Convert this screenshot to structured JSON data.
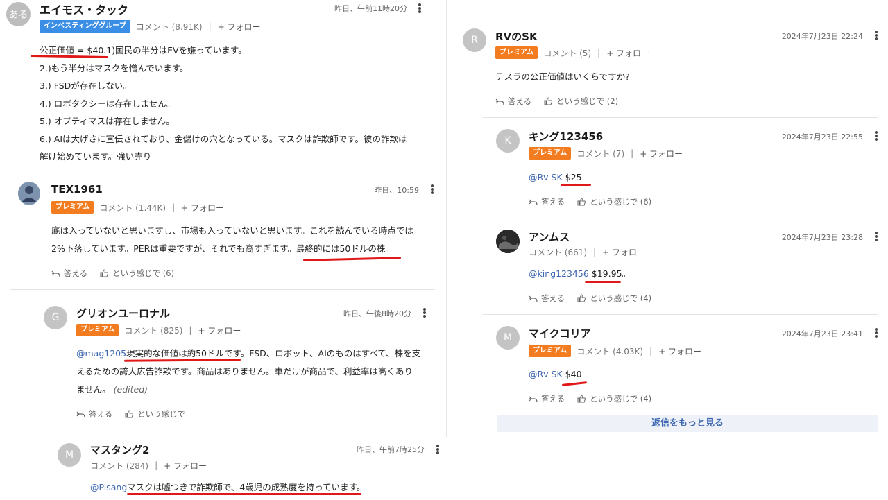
{
  "actions": {
    "reply": "答える",
    "like": "という感じで"
  },
  "left": {
    "c1": {
      "avatar_text": "ある",
      "name": "エイモス・タック",
      "time": "昨日、午前11時20分",
      "badge": "インベスティンググループ",
      "comments": "コメント (8.91K)",
      "follow": "+ フォロー",
      "lines": [
        "公正価値 = $40.1)国民の半分はEVを嫌っています。",
        "2.)もう半分はマスクを憎んでいます。",
        "3.) FSDが存在しない。",
        "4.) ロボタクシーは存在しません。",
        "5.) オプティマスは存在しません。",
        "6.) AIは大げさに宣伝されており、金儲けの穴となっている。マスクは詐欺師です。彼の詐欺は",
        "解け始めています。強い売り"
      ]
    },
    "c2": {
      "name": "TEX1961",
      "time": "昨日、10:59",
      "badge": "プレミアム",
      "comments": "コメント (1.44K)",
      "follow": "+ フォロー",
      "line1": "底は入っていないと思いますし、市場も入っていないと思います。これを読んでいる時点では",
      "line2": "2%下落しています。PERは重要ですが、それでも高すぎます。最終的には50ドルの株。",
      "likes": "という感じで (6)"
    },
    "c3": {
      "avatar_text": "G",
      "name": "グリオンユーロナル",
      "time": "昨日、午後8時20分",
      "badge": "プレミアム",
      "comments": "コメント (825)",
      "follow": "+ フォロー",
      "mention": "@mag1205",
      "line1": "現実的な価値は約50ドルです。FSD、ロボット、AIのものはすべて、株を支",
      "line2": "えるための誇大広告詐欺です。商品はありません。車だけが商品で、利益率は高くあり",
      "line3": "ません。",
      "edited": "(edited)",
      "likes": "という感じで"
    },
    "c4": {
      "avatar_text": "M",
      "name": "マスタング2",
      "time": "昨日、午前7時25分",
      "comments": "コメント (284)",
      "follow": "+ フォロー",
      "mention": "@Pisang",
      "text": "マスクは嘘つきで詐欺師で、4歳児の成熟度を持っています。"
    }
  },
  "right": {
    "c1": {
      "avatar_text": "R",
      "name": "RVのSK",
      "time": "2024年7月23日 22:24",
      "badge": "プレミアム",
      "comments": "コメント (5)",
      "follow": "+ フォロー",
      "text": "テスラの公正価値はいくらですか?",
      "likes": "という感じで (2)"
    },
    "c2": {
      "avatar_text": "K",
      "name": "キング123456",
      "time": "2024年7月23日 22:55",
      "badge": "プレミアム",
      "comments": "コメント (7)",
      "follow": "+ フォロー",
      "mention": "@Rv SK",
      "text": "$25",
      "likes": "という感じで (6)"
    },
    "c3": {
      "name": "アンムス",
      "time": "2024年7月23日 23:28",
      "comments": "コメント (661)",
      "follow": "+ フォロー",
      "mention": "@king123456",
      "text": "$19.95。",
      "likes": "という感じで (4)"
    },
    "c4": {
      "avatar_text": "M",
      "name": "マイクコリア",
      "time": "2024年7月23日 23:41",
      "badge": "プレミアム",
      "comments": "コメント (4.03K)",
      "follow": "+ フォロー",
      "mention": "@Rv SK",
      "text": "$40",
      "likes": "という感じで (4)"
    },
    "load_more": "返信をもっと見る"
  },
  "colors": {
    "premium": "#f47c20",
    "investing_group": "#3a8ee6",
    "mention": "#3e67b1",
    "annotation": "#e01818"
  }
}
